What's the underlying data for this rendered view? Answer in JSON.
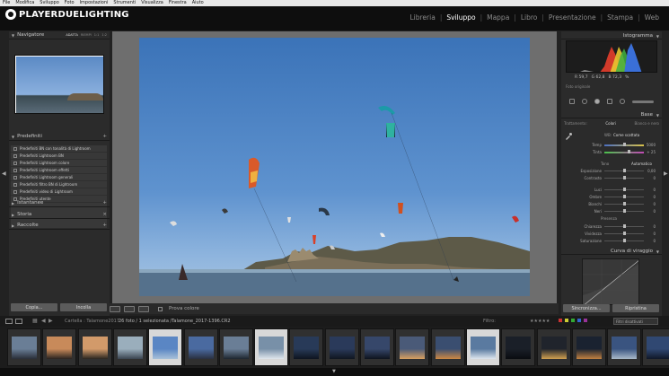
{
  "menu": [
    "File",
    "Modifica",
    "Sviluppo",
    "Foto",
    "Impostazioni",
    "Strumenti",
    "Visualizza",
    "Finestra",
    "Aiuto"
  ],
  "logo_text": "PLAYERDUELIGHTING",
  "modules": [
    {
      "label": "Libreria",
      "active": false
    },
    {
      "label": "Sviluppo",
      "active": true
    },
    {
      "label": "Mappa",
      "active": false
    },
    {
      "label": "Libro",
      "active": false
    },
    {
      "label": "Presentazione",
      "active": false
    },
    {
      "label": "Stampa",
      "active": false
    },
    {
      "label": "Web",
      "active": false
    }
  ],
  "left_panel": {
    "navigator": {
      "title": "Navigatore",
      "options": [
        "ADATTA",
        "RIEMPI",
        "1:1",
        "1:2"
      ]
    },
    "presets": {
      "title": "Predefiniti",
      "items": [
        "Predefiniti BN con tonalità di Lightroom",
        "Predefiniti Lightroom BN",
        "Predefiniti Lightroom colore",
        "Predefiniti Lightroom effetti",
        "Predefiniti Lightroom generali",
        "Predefiniti filtro BN di Lightroom",
        "Predefiniti video di Lightroom",
        "Predefiniti utente"
      ]
    },
    "snapshots": "Istantanee",
    "history": "Storia",
    "collections": "Raccolte",
    "copy_button": "Copia...",
    "paste_button": "Incolla"
  },
  "toolbar": {
    "soft_proof_label": "Prova colore"
  },
  "right_panel": {
    "histogram_title": "Istogramma",
    "readout": {
      "r": "R  59,7",
      "g": "G  62,8",
      "b": "B  72,3",
      "unit": "%"
    },
    "original_label": "Foto originale",
    "basic_title": "Base",
    "treatment_label": "Trattamento:",
    "treatment_options": [
      "Colori",
      "Bianco e nero"
    ],
    "wb_label": "WB:",
    "wb_value": "Come scattata",
    "tone_label": "Tono",
    "tone_auto": "Automatico",
    "presence_label": "Presenza",
    "sliders": [
      {
        "label": "Temp",
        "value": "5000",
        "pos": 0.5
      },
      {
        "label": "Tinta",
        "value": "+ 25",
        "pos": 0.62
      },
      {
        "label": "Esposizione",
        "value": "0,00",
        "pos": 0.5
      },
      {
        "label": "Contrasto",
        "value": "0",
        "pos": 0.5
      },
      {
        "label": "Luci",
        "value": "0",
        "pos": 0.5
      },
      {
        "label": "Ombre",
        "value": "0",
        "pos": 0.5
      },
      {
        "label": "Bianchi",
        "value": "0",
        "pos": 0.5
      },
      {
        "label": "Neri",
        "value": "0",
        "pos": 0.5
      },
      {
        "label": "Chiarezza",
        "value": "0",
        "pos": 0.5
      },
      {
        "label": "Vividezza",
        "value": "0",
        "pos": 0.5
      },
      {
        "label": "Saturazione",
        "value": "0",
        "pos": 0.5
      }
    ],
    "curve_title": "Curva di viraggio",
    "sync_button": "Sincronizza...",
    "reset_button": "Ripristina"
  },
  "filmstrip_bar": {
    "folder": "Cartella : Talamone2017",
    "count": "26 foto / 1 selezionata /Talamone_2017-1396.CR2",
    "filter_label": "Filtro:",
    "filter_value": "Filtri disattivati"
  },
  "colors": {
    "accent": "#ffffff",
    "panel": "#2b2b2b",
    "background": "#222222"
  }
}
